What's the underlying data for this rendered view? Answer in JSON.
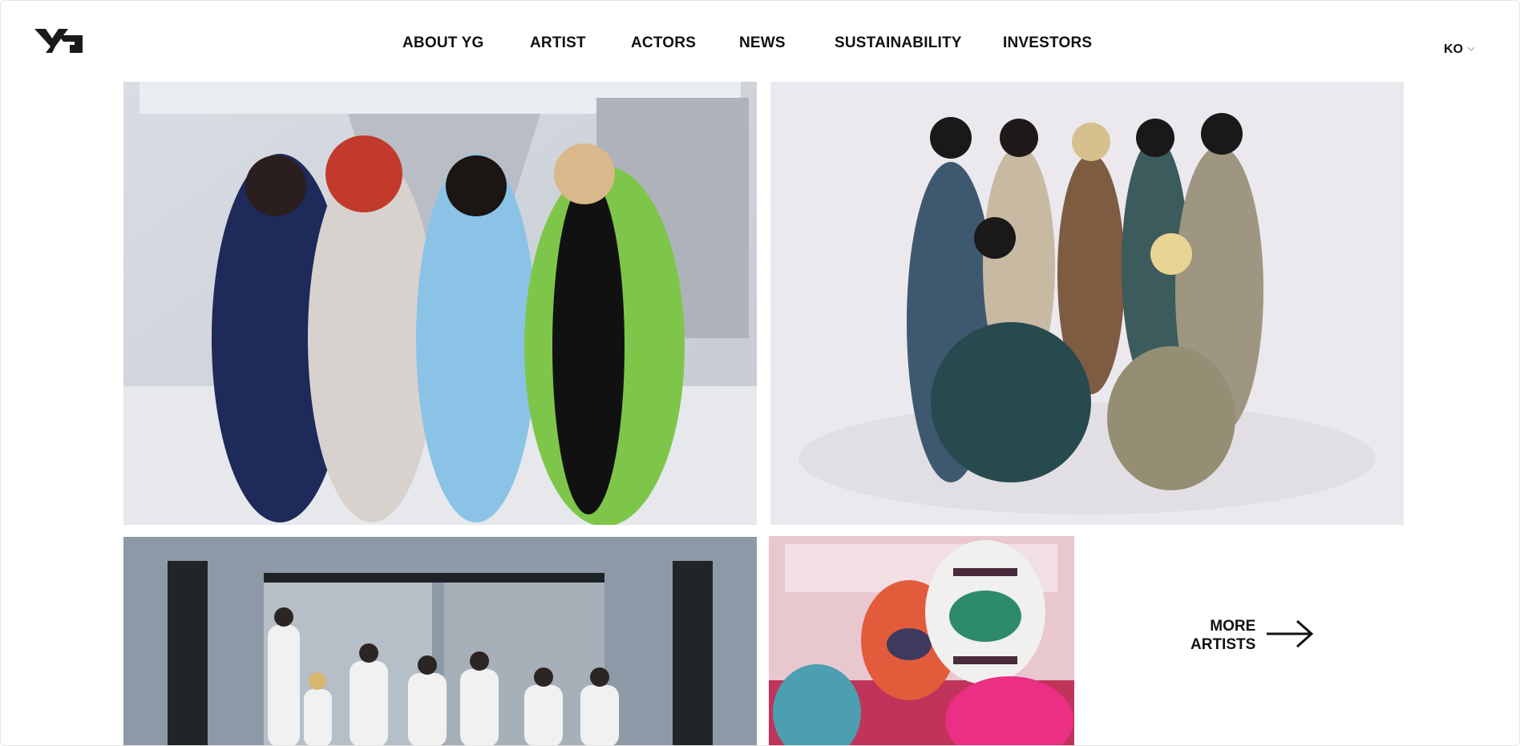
{
  "brand": {
    "logo_icon": "yg-logo-icon",
    "accent": "#111111"
  },
  "nav": {
    "items": [
      {
        "label": "ABOUT YG"
      },
      {
        "label": "ARTIST"
      },
      {
        "label": "ACTORS"
      },
      {
        "label": "NEWS"
      },
      {
        "label": "SUSTAINABILITY"
      },
      {
        "label": "INVESTORS"
      }
    ]
  },
  "language": {
    "selected": "KO",
    "icon": "chevron-down-icon"
  },
  "artists": {
    "tiles": [
      {
        "icon": "artist-photo-1"
      },
      {
        "icon": "artist-photo-2"
      },
      {
        "icon": "artist-photo-3"
      },
      {
        "icon": "artist-photo-4"
      }
    ],
    "more": {
      "line1": "MORE",
      "line2": "ARTISTS",
      "icon": "arrow-right-icon"
    }
  }
}
